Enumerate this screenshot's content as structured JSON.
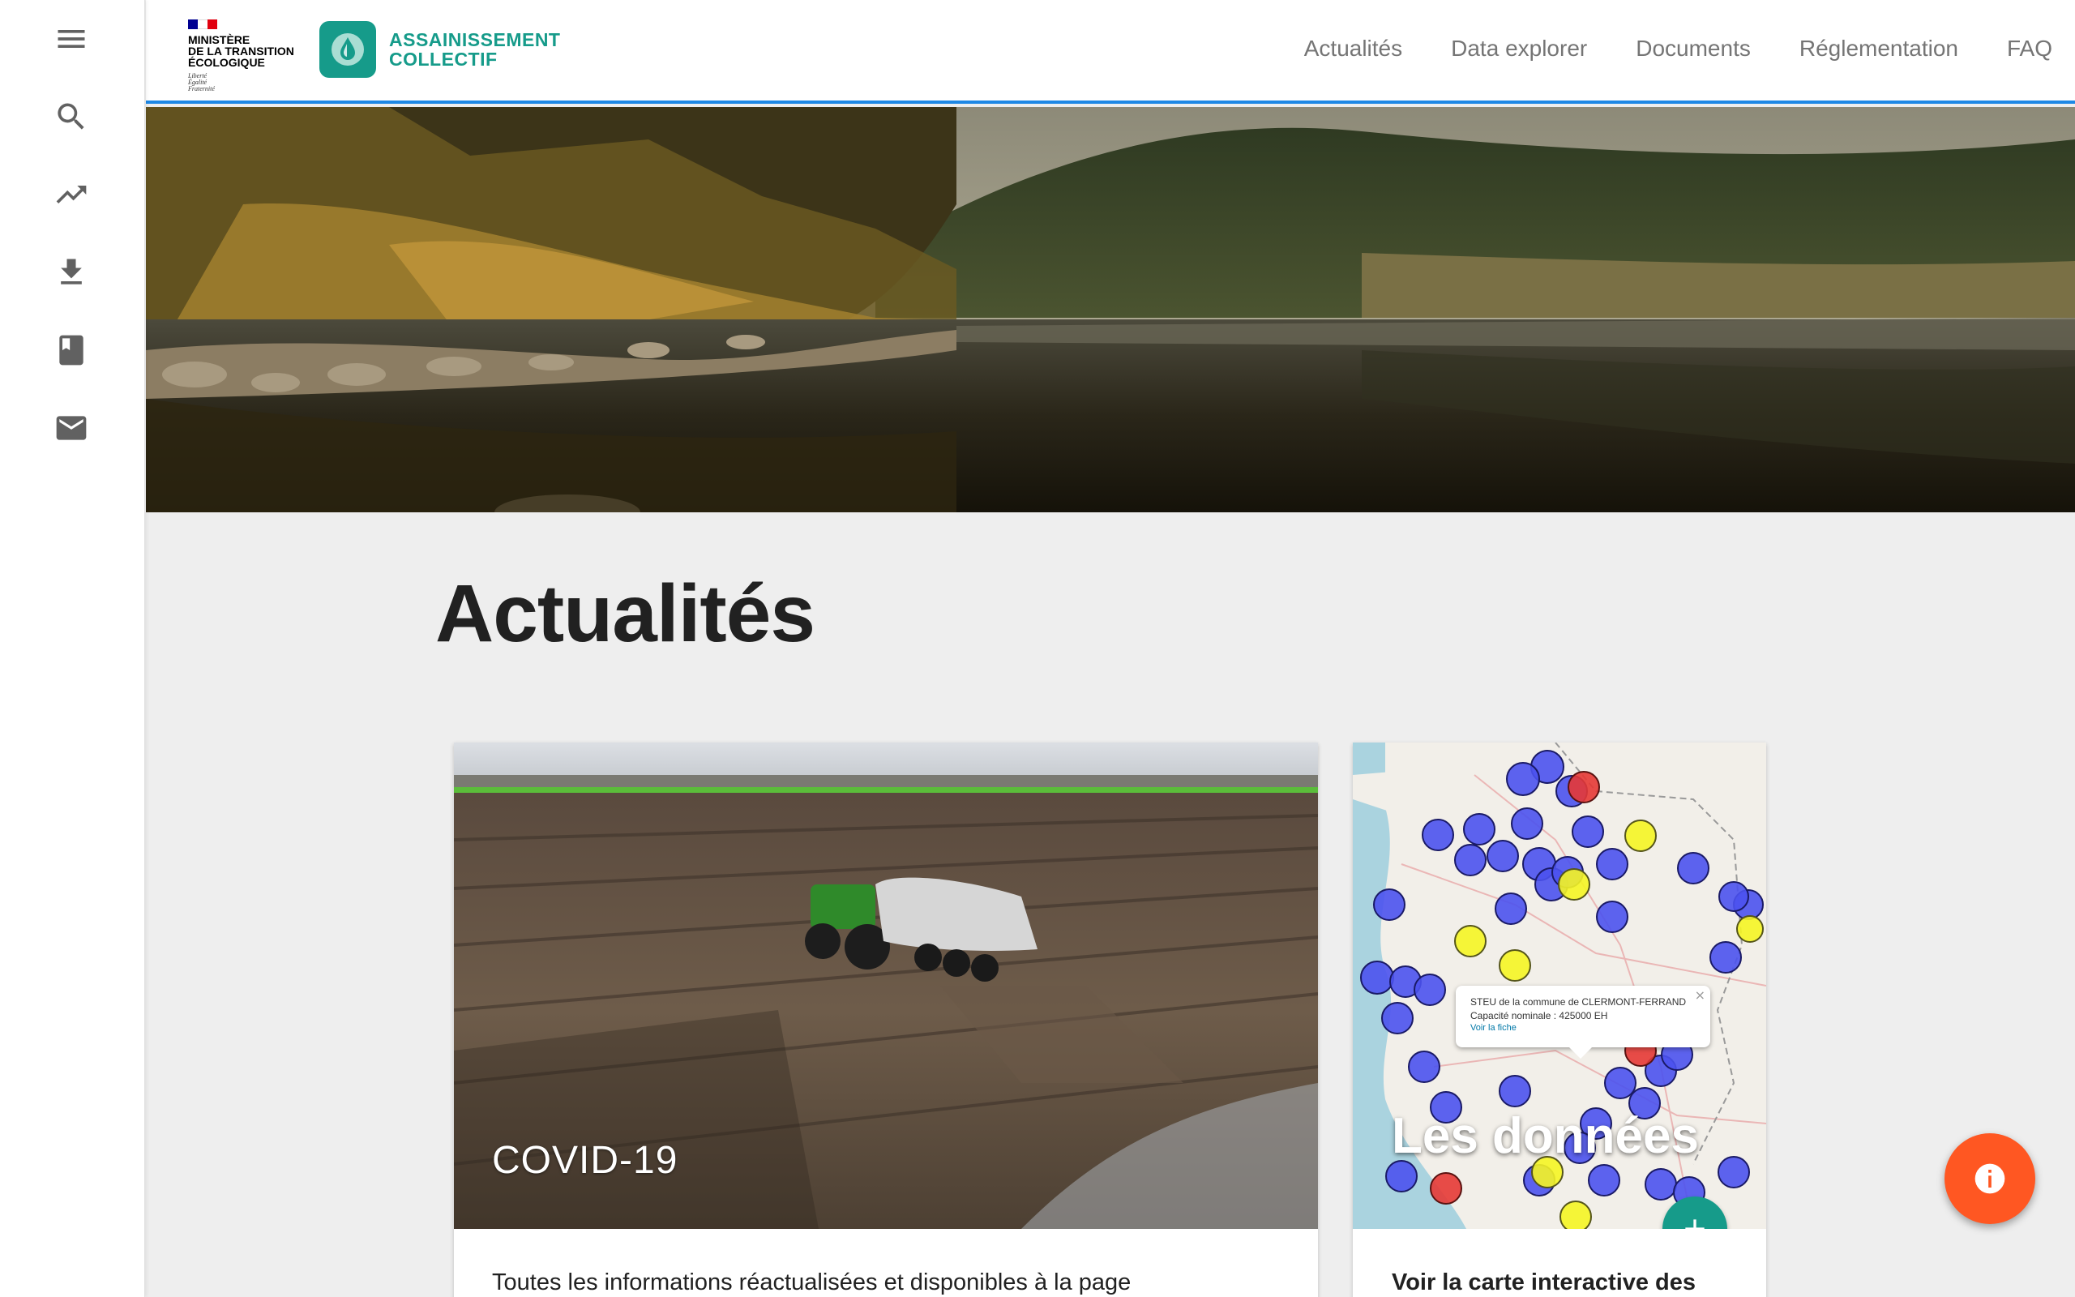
{
  "sidebar": {
    "items": [
      {
        "icon": "menu-icon"
      },
      {
        "icon": "search-icon"
      },
      {
        "icon": "trending-up-icon"
      },
      {
        "icon": "download-icon"
      },
      {
        "icon": "book-icon"
      },
      {
        "icon": "mail-icon"
      }
    ]
  },
  "header": {
    "ministry_name": "MINISTÈRE\nDE LA TRANSITION\nÉCOLOGIQUE",
    "ministry_motto": "Liberté\nÉgalité\nFraternité",
    "app_name_line1": "ASSAINISSEMENT",
    "app_name_line2": "COLLECTIF",
    "nav": [
      "Actualités",
      "Data explorer",
      "Documents",
      "Réglementation",
      "FAQ"
    ]
  },
  "main": {
    "title": "Actualités",
    "cards": [
      {
        "label": "COVID-19",
        "text": "Toutes les informations réactualisées et disponibles à la page"
      },
      {
        "label": "Les données",
        "text": "Voir la carte interactive des"
      }
    ],
    "map_popup": {
      "line1": "STEU de la commune de CLERMONT-FERRAND",
      "line2": "Capacité nominale : 425000 EH",
      "link": "Voir la fiche",
      "close": "×"
    }
  },
  "colors": {
    "brand_teal": "#169b8a",
    "header_border": "#1e88e5",
    "fab_info": "#ff5722",
    "marker_blue": "#3f51f5",
    "marker_yellow": "#f5f524",
    "marker_red": "#e53935"
  }
}
